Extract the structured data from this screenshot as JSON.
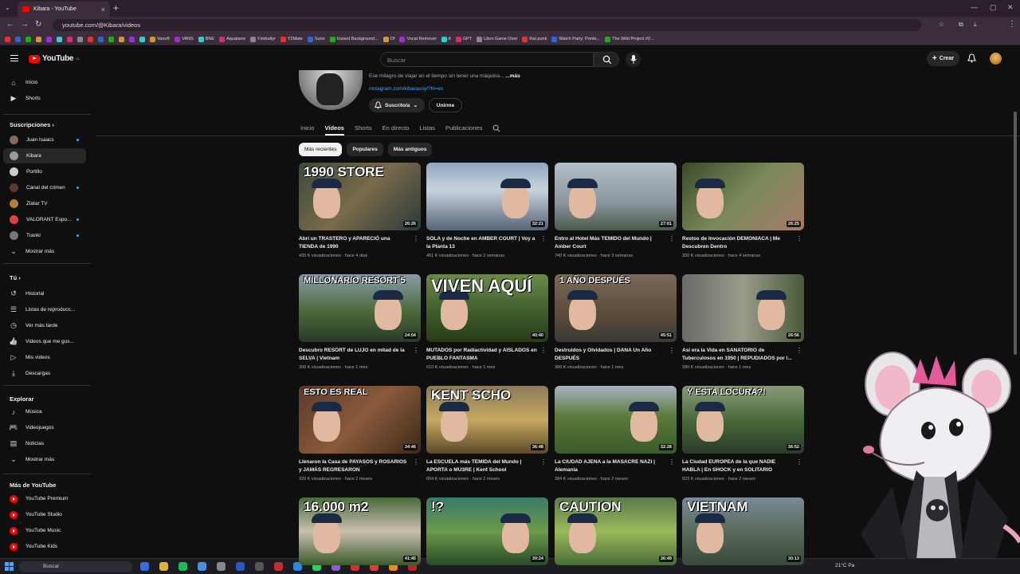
{
  "browser": {
    "tab_title": "Kibara - YouTube",
    "url": "youtube.com/@Kibara/videos",
    "bookmarks": [
      "Vans®",
      "VANS",
      "BNE",
      "Aquatarre",
      "Fimbultyr",
      "Y2Mate",
      "Suno",
      "Instant Background...",
      "Of",
      "Vocal Remover",
      "tt",
      "GPT",
      "Libro Game Over",
      "Rat punk",
      "Watch Party: Ponte...",
      "The Wild Project #2..."
    ]
  },
  "header": {
    "logo_text": "YouTube",
    "logo_country": "CL",
    "search_placeholder": "Buscar",
    "create_label": "Crear"
  },
  "sidebar": {
    "main": [
      {
        "label": "Inicio",
        "icon": "home-icon"
      },
      {
        "label": "Shorts",
        "icon": "shorts-icon"
      }
    ],
    "subscriptions_title": "Suscripciones",
    "subscriptions": [
      {
        "label": "Juan Isaacs",
        "color": "#8a6a55",
        "dot": true
      },
      {
        "label": "Kibara",
        "color": "#9a9a9a",
        "dot": false,
        "active": true
      },
      {
        "label": "Portillo",
        "color": "#cccccc",
        "dot": false
      },
      {
        "label": "Canal del crimen",
        "color": "#5a3a30",
        "dot": true
      },
      {
        "label": "Zlatar TV",
        "color": "#b08040",
        "dot": false
      },
      {
        "label": "VALORANT Espo...",
        "color": "#e04040",
        "dot": true
      },
      {
        "label": "Tranki",
        "color": "#777777",
        "dot": true
      }
    ],
    "show_more": "Mostrar más",
    "you_title": "Tú",
    "you_items": [
      {
        "label": "Historial",
        "icon": "history-icon"
      },
      {
        "label": "Listas de reproducc...",
        "icon": "playlist-icon"
      },
      {
        "label": "Ver más tarde",
        "icon": "clock-icon"
      },
      {
        "label": "Videos que me gus...",
        "icon": "like-icon"
      },
      {
        "label": "Mis videos",
        "icon": "my-videos-icon"
      },
      {
        "label": "Descargas",
        "icon": "download-icon"
      }
    ],
    "explore_title": "Explorar",
    "explore_items": [
      {
        "label": "Música",
        "icon": "music-icon"
      },
      {
        "label": "Videojuegos",
        "icon": "gaming-icon"
      },
      {
        "label": "Noticias",
        "icon": "news-icon"
      },
      {
        "label": "Mostrar más",
        "icon": "chevron-down-icon"
      }
    ],
    "more_title": "Más de YouTube",
    "more_items": [
      "YouTube Premium",
      "YouTube Studio",
      "YouTube Music",
      "YouTube Kids"
    ]
  },
  "channel": {
    "description": "Ese milagro de viajar en el tiempo sin tener una máquina...",
    "more": "...más",
    "link": "instagram.com/kibarasoy/?hl=es",
    "subscribed_label": "Suscrito/a",
    "join_label": "Unirme",
    "tabs": [
      "Inicio",
      "Videos",
      "Shorts",
      "En directo",
      "Listas",
      "Publicaciones"
    ],
    "active_tab": "Videos",
    "chips": [
      "Más recientes",
      "Populares",
      "Más antiguos"
    ]
  },
  "videos": [
    {
      "title": "Abrí un TRASTERO y APARECIÓ una TIENDA de 1990",
      "meta": "435 K visualizaciones · hace 4 días",
      "duration": "26:26",
      "overlay": "1990 STORE",
      "bg": "linear-gradient(135deg,#3a4a3a,#7a6a4a 50%,#2a3a3a)"
    },
    {
      "title": "SOLA y de Noche en AMBER COURT | Voy a la Planta 13",
      "meta": "461 K visualizaciones · hace 2 semanas",
      "duration": "32:21",
      "overlay": "",
      "bg": "linear-gradient(180deg,#8fa5c0,#c9d3de 40%,#566478)"
    },
    {
      "title": "Entro al Hotel Más TEMIDO del Mundo | Amber Court",
      "meta": "740 K visualizaciones · hace 3 semanas",
      "duration": "27:01",
      "overlay": "",
      "bg": "linear-gradient(180deg,#b4bec8,#8a949c 60%,#4a5a4a)"
    },
    {
      "title": "Restos de Invocación DEMONIACA | Me Descubren Dentro",
      "meta": "330 K visualizaciones · hace 4 semanas",
      "duration": "26:25",
      "overlay": "",
      "bg": "linear-gradient(135deg,#3a4a2a,#7a8a5a 50%,#a87a6a)"
    },
    {
      "title": "Descubro RESORT de LUJO en mitad de la SELVA | Vietnam",
      "meta": "300 K visualizaciones · hace 1 mes",
      "duration": "24:04",
      "overlay": "MILLONARIO RESORT 5",
      "bg": "linear-gradient(180deg,#8a9aa8,#4a6a3a 55%,#2a3a2a)"
    },
    {
      "title": "MUTADOS por Radiactividad y AISLADOS en PUEBLO FANTASMA",
      "meta": "610 K visualizaciones · hace 1 mes",
      "duration": "40:40",
      "overlay": "VIVEN AQUÍ",
      "bg": "linear-gradient(180deg,#6a8a4a,#3a5a2a 60%,#2a3a1a)"
    },
    {
      "title": "Destruidos y Olvidados | DANA Un Año DESPUÉS",
      "meta": "386 K visualizaciones · hace 1 mes",
      "duration": "45:51",
      "overlay": "1 AÑO DESPUÉS",
      "bg": "linear-gradient(180deg,#7a6a5a,#5a4a3a 60%,#3a3a3a)"
    },
    {
      "title": "Así era la Vida en SANATORIO de Tuberculosos en 1950 | REPUDIADOS por l...",
      "meta": "280 K visualizaciones · hace 1 mes",
      "duration": "26:56",
      "overlay": "",
      "bg": "linear-gradient(90deg,#6a6a6a,#9a9a8a 50%,#4a5a3a)"
    },
    {
      "title": "Llenaron la Casa de PAYASOS y ROSARIOS y JAMÁS REGRESARON",
      "meta": "320 K visualizaciones · hace 2 meses",
      "duration": "34:46",
      "overlay": "ESTO ES REAL",
      "bg": "linear-gradient(135deg,#5a3a2a,#8a5a3a 50%,#3a2a1a)"
    },
    {
      "title": "La ESCUELA más TEMIDA del Mundo | APORTA o MU3RE | Kent School",
      "meta": "654 K visualizaciones · hace 2 meses",
      "duration": "36:48",
      "overlay": "KENT SCHO",
      "bg": "linear-gradient(180deg,#8a7a5a,#c8a860 50%,#5a4a2a)"
    },
    {
      "title": "La CIUDAD AJENA a la MASACRE NAZI | Alemania",
      "meta": "384 K visualizaciones · hace 2 meses",
      "duration": "32:28",
      "overlay": "",
      "bg": "linear-gradient(180deg,#aab4c0,#5a7a3a 45%,#3a5a2a)"
    },
    {
      "title": "La Ciudad EUROPEA de la que NADIE HABLA | En SHOCK y en SOLITARIO",
      "meta": "923 K visualizaciones · hace 2 meses",
      "duration": "36:52",
      "overlay": "Y ESTA LOCURA?!",
      "bg": "linear-gradient(180deg,#8a9a7a,#4a6a3a 50%,#2a3a2a)"
    },
    {
      "title": "",
      "meta": "",
      "duration": "41:45",
      "overlay": "16.000 m2",
      "bg": "linear-gradient(180deg,#4a6a3a,#c8c0b0 50%,#3a5a2a)"
    },
    {
      "title": "",
      "meta": "",
      "duration": "39:24",
      "overlay": "!?",
      "bg": "linear-gradient(180deg,#3a7a6a,#6a9a4a 50%,#2a4a2a)"
    },
    {
      "title": "",
      "meta": "",
      "duration": "36:49",
      "overlay": "CAUTION",
      "bg": "linear-gradient(180deg,#5a7a4a,#9aba5a 50%,#4a6a3a)"
    },
    {
      "title": "",
      "meta": "",
      "duration": "30:13",
      "overlay": "VIETNAM",
      "bg": "linear-gradient(180deg,#7a8a9a,#5a6a5a 50%,#3a4a3a)"
    }
  ],
  "taskbar": {
    "search_placeholder": "Buscar",
    "weather": "21°C Pa"
  }
}
